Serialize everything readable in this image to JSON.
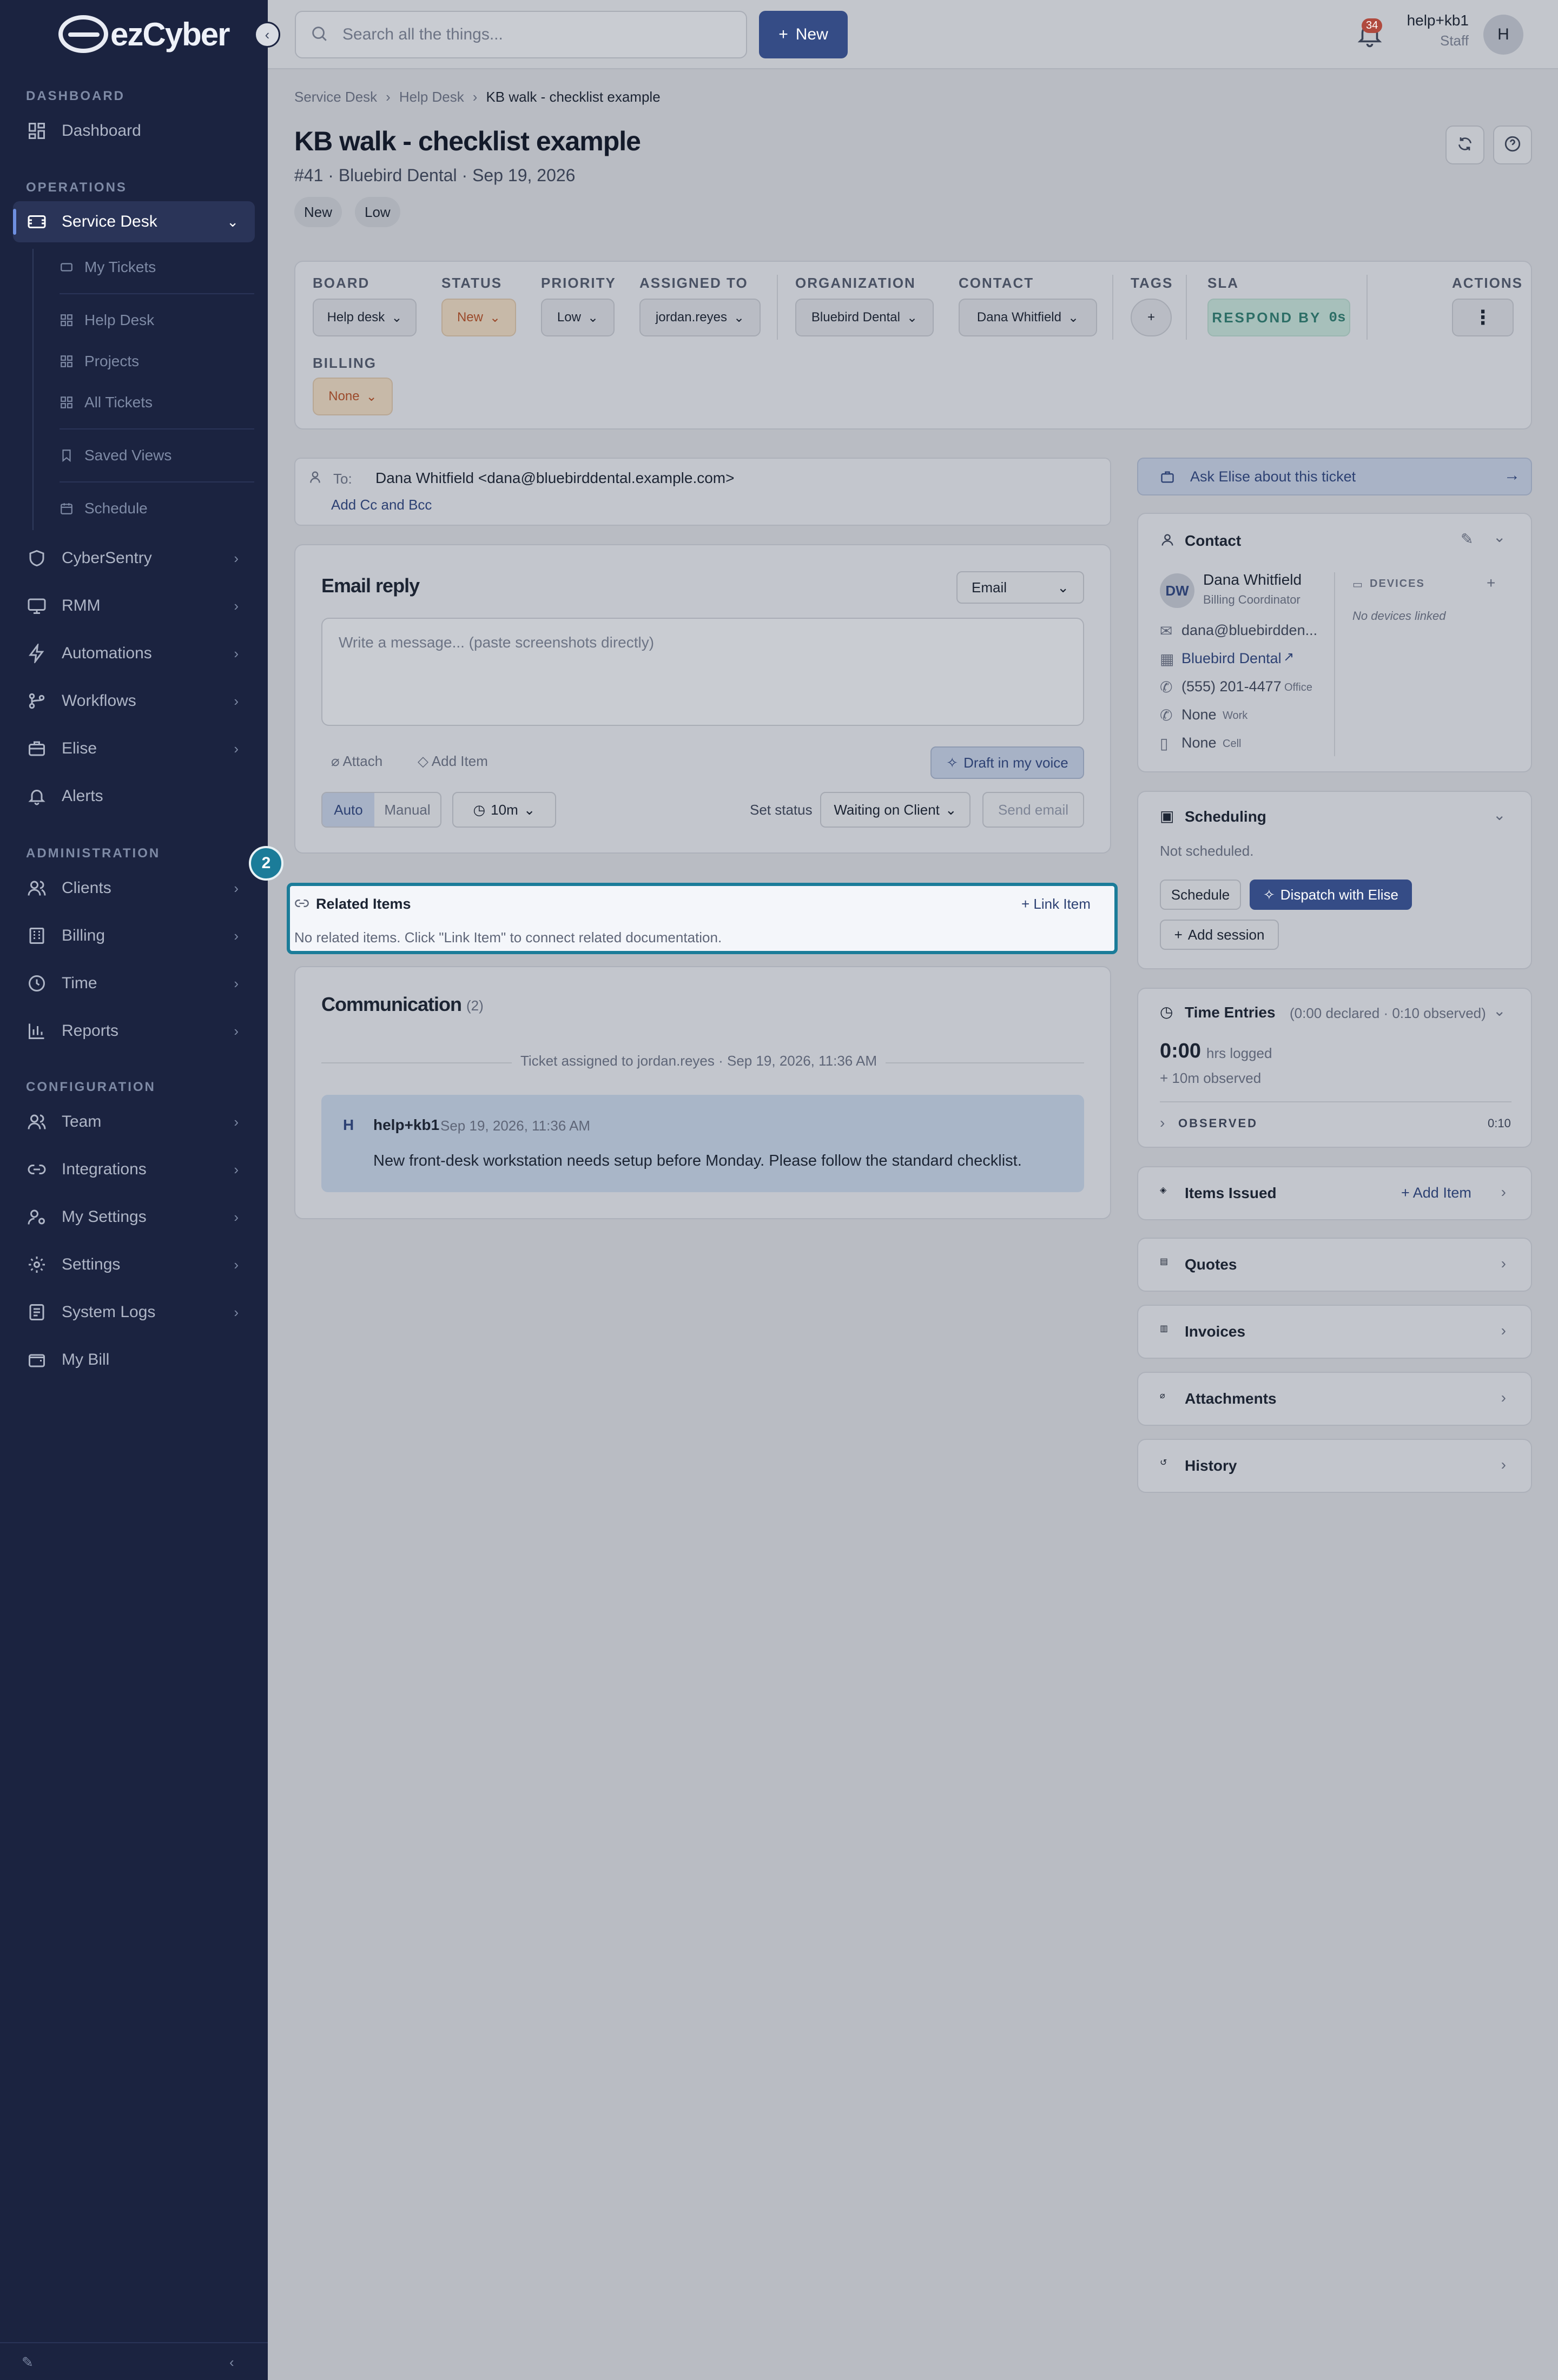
{
  "brand": {
    "name": "ezCyber"
  },
  "sidebar": {
    "sections": {
      "dashboard": "DASHBOARD",
      "operations": "OPERATIONS",
      "administration": "ADMINISTRATION",
      "configuration": "CONFIGURATION"
    },
    "dashboard": "Dashboard",
    "service_desk": "Service Desk",
    "sub": {
      "my_tickets": "My Tickets",
      "help_desk": "Help Desk",
      "projects": "Projects",
      "all_tickets": "All Tickets",
      "saved_views": "Saved Views",
      "schedule": "Schedule"
    },
    "cybersentry": "CyberSentry",
    "rmm": "RMM",
    "automations": "Automations",
    "workflows": "Workflows",
    "elise": "Elise",
    "alerts": "Alerts",
    "clients": "Clients",
    "billing": "Billing",
    "time": "Time",
    "reports": "Reports",
    "team": "Team",
    "integrations": "Integrations",
    "my_settings": "My Settings",
    "settings": "Settings",
    "system_logs": "System Logs",
    "my_bill": "My Bill"
  },
  "topbar": {
    "search_placeholder": "Search all the things...",
    "new_label": "New",
    "notifications": "34",
    "user_name": "help+kb1",
    "user_role": "Staff",
    "avatar": "H"
  },
  "breadcrumb": [
    "Service Desk",
    "Help Desk",
    "KB walk - checklist example"
  ],
  "ticket": {
    "title": "KB walk - checklist example",
    "subtitle": "#41 · Bluebird Dental · Sep 19, 2026",
    "tags": [
      "New",
      "Low"
    ]
  },
  "fields": {
    "board": {
      "label": "BOARD",
      "value": "Help desk"
    },
    "status": {
      "label": "STATUS",
      "value": "New"
    },
    "priority": {
      "label": "PRIORITY",
      "value": "Low"
    },
    "assigned": {
      "label": "ASSIGNED TO",
      "value": "jordan.reyes"
    },
    "organization": {
      "label": "ORGANIZATION",
      "value": "Bluebird Dental"
    },
    "contact": {
      "label": "CONTACT",
      "value": "Dana Whitfield"
    },
    "tags": {
      "label": "TAGS"
    },
    "sla": {
      "label": "SLA",
      "value": "RESPOND BY",
      "timer": "0s"
    },
    "actions": {
      "label": "ACTIONS"
    },
    "billing": {
      "label": "BILLING",
      "value": "None"
    }
  },
  "recipients": {
    "to_label": "To:",
    "to_value": "Dana Whitfield <dana@bluebirddental.example.com>",
    "add_cc": "Add Cc and Bcc"
  },
  "reply": {
    "title": "Email reply",
    "channel": "Email",
    "placeholder": "Write a message... (paste screenshots directly)",
    "attach": "Attach",
    "add_item": "Add Item",
    "draft": "Draft in my voice",
    "auto": "Auto",
    "manual": "Manual",
    "duration": "10m",
    "set_status_label": "Set status",
    "set_status_value": "Waiting on Client",
    "send": "Send email"
  },
  "step_badge": "2",
  "related": {
    "title": "Related Items",
    "link": "Link Item",
    "empty": "No related items. Click \"Link Item\" to connect related documentation."
  },
  "communication": {
    "title": "Communication",
    "count": "(2)",
    "system_event": "Ticket assigned to jordan.reyes · Sep 19, 2026, 11:36 AM",
    "message": {
      "avatar": "H",
      "author": "help+kb1",
      "time": "Sep 19, 2026, 11:36 AM",
      "body": "New front-desk workstation needs setup before Monday. Please follow the standard checklist."
    }
  },
  "right": {
    "ask_elise": "Ask Elise about this ticket",
    "contact": {
      "title": "Contact",
      "initials": "DW",
      "name": "Dana Whitfield",
      "role": "Billing Coordinator",
      "email": "dana@bluebirdden...",
      "org": "Bluebird Dental",
      "phone": "(555) 201-4477",
      "phone_type": "Office",
      "work": "None",
      "work_type": "Work",
      "cell": "None",
      "cell_type": "Cell",
      "devices_label": "DEVICES",
      "devices_empty": "No devices linked"
    },
    "scheduling": {
      "title": "Scheduling",
      "status": "Not scheduled.",
      "schedule": "Schedule",
      "dispatch": "Dispatch with Elise",
      "add_session": "Add session"
    },
    "time": {
      "title": "Time Entries",
      "summary": "(0:00 declared · 0:10 observed)",
      "logged": "0:00",
      "logged_label": "hrs logged",
      "observed_note": "+ 10m observed",
      "observed_label": "OBSERVED",
      "observed_value": "0:10"
    },
    "items_issued": {
      "title": "Items Issued",
      "add": "Add Item"
    },
    "quotes": "Quotes",
    "invoices": "Invoices",
    "attachments": "Attachments",
    "history": "History"
  },
  "colors": {
    "sidebar": "#1b2340",
    "accent": "#354c86",
    "highlight": "#1b7c99",
    "warm": "#9b4a2b"
  }
}
